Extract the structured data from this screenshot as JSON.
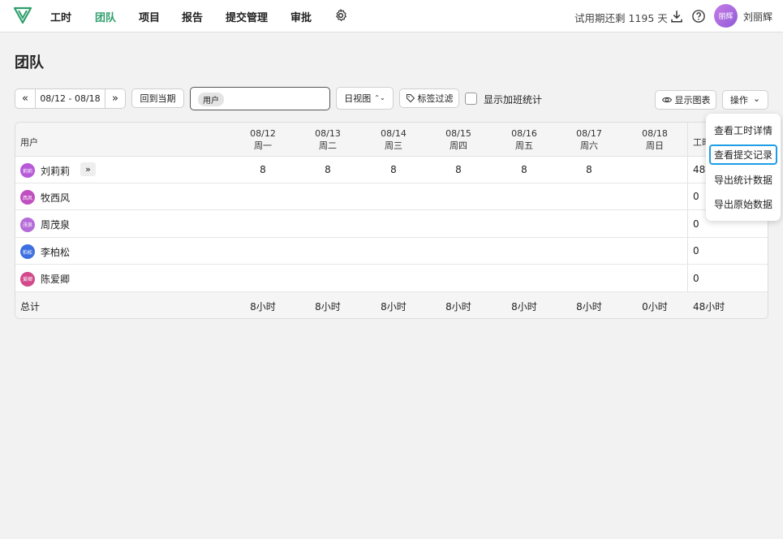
{
  "nav": {
    "items": [
      "工时",
      "团队",
      "项目",
      "报告",
      "提交管理",
      "审批"
    ],
    "active_index": 1,
    "trial_text": "试用期还剩 1195 天",
    "avatar_text": "丽辉",
    "username": "刘丽辉"
  },
  "page": {
    "title": "团队"
  },
  "toolbar": {
    "prev": "«",
    "date_range": "08/12 - 08/18",
    "next": "»",
    "current_period": "回到当期",
    "filter_chip": "用户",
    "view_mode": "日视图",
    "view_arrow": "⌃⌄",
    "tag_filter": "标签过滤",
    "overtime_label": "显示加班统计",
    "show_chart": "显示图表",
    "actions": "操作",
    "actions_arrow": "⌄"
  },
  "table": {
    "user_header": "用户",
    "total_header": "工时",
    "days": [
      {
        "date": "08/12",
        "weekday": "周一"
      },
      {
        "date": "08/13",
        "weekday": "周二"
      },
      {
        "date": "08/14",
        "weekday": "周三"
      },
      {
        "date": "08/15",
        "weekday": "周四"
      },
      {
        "date": "08/16",
        "weekday": "周五"
      },
      {
        "date": "08/17",
        "weekday": "周六"
      },
      {
        "date": "08/18",
        "weekday": "周日"
      }
    ],
    "rows": [
      {
        "avatar": "莉莉",
        "avatar_color": "#b65ad9",
        "name": "刘莉莉",
        "expand": "»",
        "values": [
          "8",
          "8",
          "8",
          "8",
          "8",
          "8",
          ""
        ],
        "total": "48"
      },
      {
        "avatar": "西风",
        "avatar_color": "#c04fc0",
        "name": "牧西风",
        "values": [
          "",
          "",
          "",
          "",
          "",
          "",
          ""
        ],
        "total": "0"
      },
      {
        "avatar": "茂泉",
        "avatar_color": "#b56bd8",
        "name": "周茂泉",
        "values": [
          "",
          "",
          "",
          "",
          "",
          "",
          ""
        ],
        "total": "0"
      },
      {
        "avatar": "柏松",
        "avatar_color": "#3d6fe0",
        "name": "李柏松",
        "values": [
          "",
          "",
          "",
          "",
          "",
          "",
          ""
        ],
        "total": "0"
      },
      {
        "avatar": "爱卿",
        "avatar_color": "#d24a8c",
        "name": "陈爱卿",
        "values": [
          "",
          "",
          "",
          "",
          "",
          "",
          ""
        ],
        "total": "0"
      }
    ],
    "footer": {
      "label": "总计",
      "values": [
        "8小时",
        "8小时",
        "8小时",
        "8小时",
        "8小时",
        "8小时",
        "0小时"
      ],
      "total": "48小时"
    }
  },
  "menu": {
    "items": [
      "查看工时详情",
      "查看提交记录",
      "导出统计数据",
      "导出原始数据"
    ],
    "focused_index": 1
  },
  "colors": {
    "accent": "#2e9e6b",
    "focus": "#1e9ee8"
  }
}
